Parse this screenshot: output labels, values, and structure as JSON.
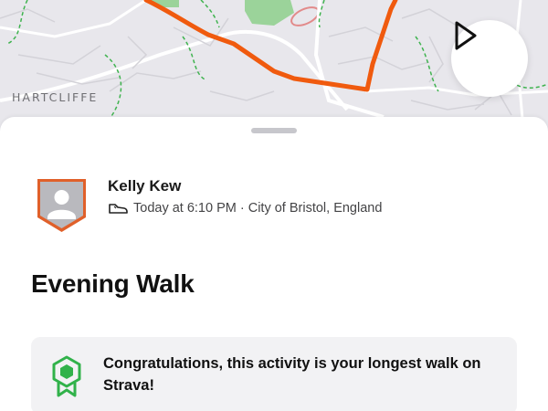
{
  "map": {
    "area_label": "HARTCLIFFE",
    "route_color": "#f05a0e",
    "park_color": "#9bd39a"
  },
  "controls": {
    "play_icon": "play-icon"
  },
  "activity": {
    "athlete_name": "Kelly Kew",
    "sport_icon": "shoe-icon",
    "meta": "Today at 6:10 PM · City of Bristol, England",
    "title": "Evening Walk",
    "achievement": {
      "icon": "ribbon-badge-icon",
      "text": "Congratulations, this activity is your longest walk on Strava!",
      "accent": "#31b24a"
    }
  },
  "colors": {
    "avatar_border": "#e0602a",
    "avatar_fill": "#b9b9be"
  }
}
